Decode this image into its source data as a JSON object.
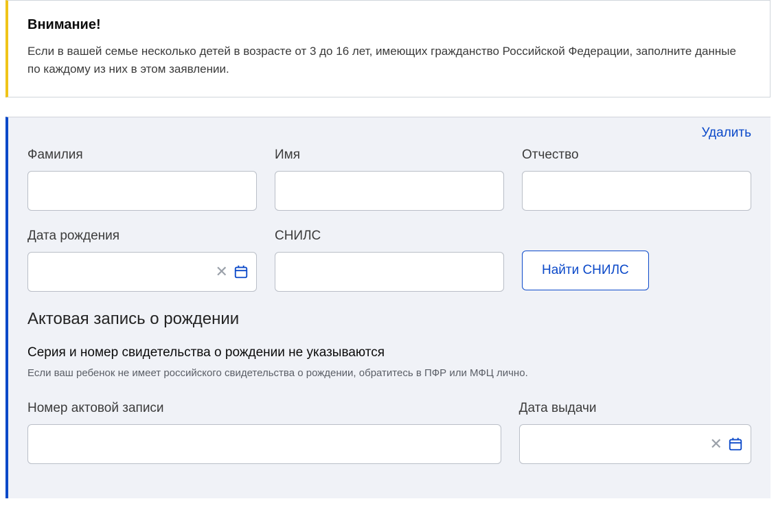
{
  "notice": {
    "title": "Внимание!",
    "text": "Если в вашей семье несколько детей в возрасте от 3 до 16 лет, имеющих гражданство Российской Федерации, заполните данные по каждому из них в этом заявлении."
  },
  "form": {
    "delete_label": "Удалить",
    "fields": {
      "surname": {
        "label": "Фамилия",
        "value": ""
      },
      "name": {
        "label": "Имя",
        "value": ""
      },
      "patronymic": {
        "label": "Отчество",
        "value": ""
      },
      "birthdate": {
        "label": "Дата рождения",
        "value": ""
      },
      "snils": {
        "label": "СНИЛС",
        "value": ""
      },
      "find_snils_button": "Найти СНИЛС"
    },
    "birth_record": {
      "section_title": "Актовая запись о рождении",
      "subtitle": "Серия и номер свидетельства о рождении не указываются",
      "hint": "Если ваш ребенок не имеет российского свидетельства о рождении, обратитесь в ПФР или МФЦ лично.",
      "record_number": {
        "label": "Номер актовой записи",
        "value": ""
      },
      "issue_date": {
        "label": "Дата выдачи",
        "value": ""
      }
    }
  }
}
